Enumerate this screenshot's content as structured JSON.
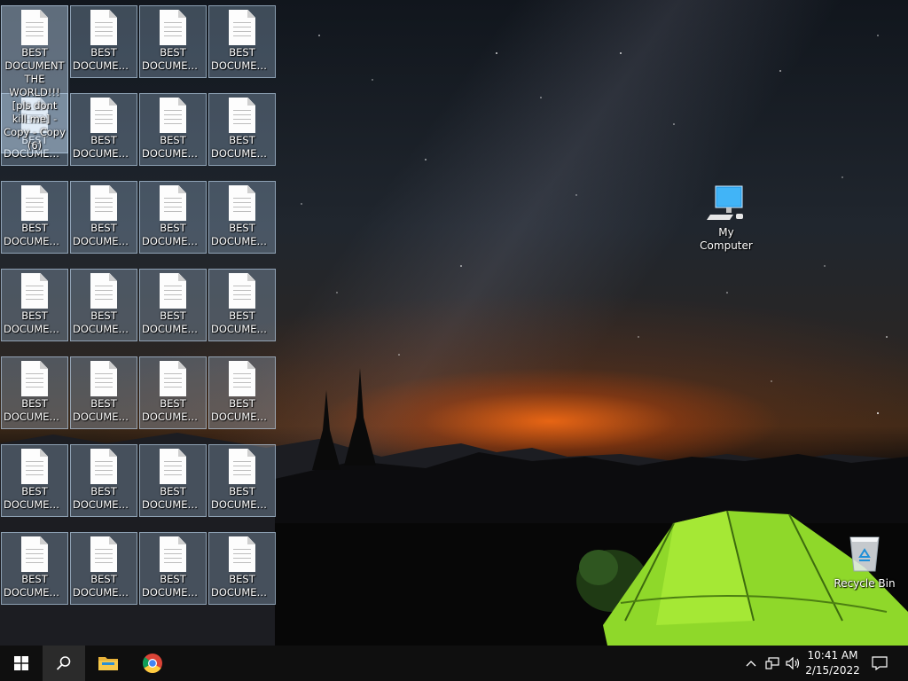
{
  "desktop": {
    "icons": [
      [
        "BEST",
        "DOCUMENT..."
      ],
      [
        "BEST",
        "DOCUMENT..."
      ],
      [
        "BEST",
        "DOCUMENT..."
      ],
      [
        "BEST",
        "DOCUMENT..."
      ]
    ],
    "selected_file_label": "BEST DOCUMENT THE WORLD!!! [pls dont kill me] - Copy - Copy (6)",
    "my_computer_label": "My Computer",
    "recycle_bin_label": "Recycle Bin"
  },
  "file_grid": {
    "row_labels": [
      "BEST DOCUMENT...",
      "BEST DOCUMENT...",
      "BEST DOCUMENT...",
      "BEST DOCUMENT...",
      "BEST DOCUMENT...",
      "BEST DOCUMENT...",
      "BEST DOCUMENT..."
    ],
    "line1": "BEST",
    "line2": "DOCUMENT..."
  },
  "taskbar": {
    "start_icon": "windows-logo-icon",
    "search_icon": "search-icon",
    "file_explorer_icon": "folder-icon",
    "chrome_icon": "chrome-icon",
    "tray": [
      "chevron-up-icon",
      "network-icon",
      "volume-icon"
    ],
    "time": "10:41 AM",
    "date": "2/15/2022",
    "notification_icon": "action-center-icon"
  },
  "colors": {
    "taskbar_bg": "#0f0f0f",
    "icon_selection": "#aac8e6",
    "tent_green": "#9be52c"
  }
}
